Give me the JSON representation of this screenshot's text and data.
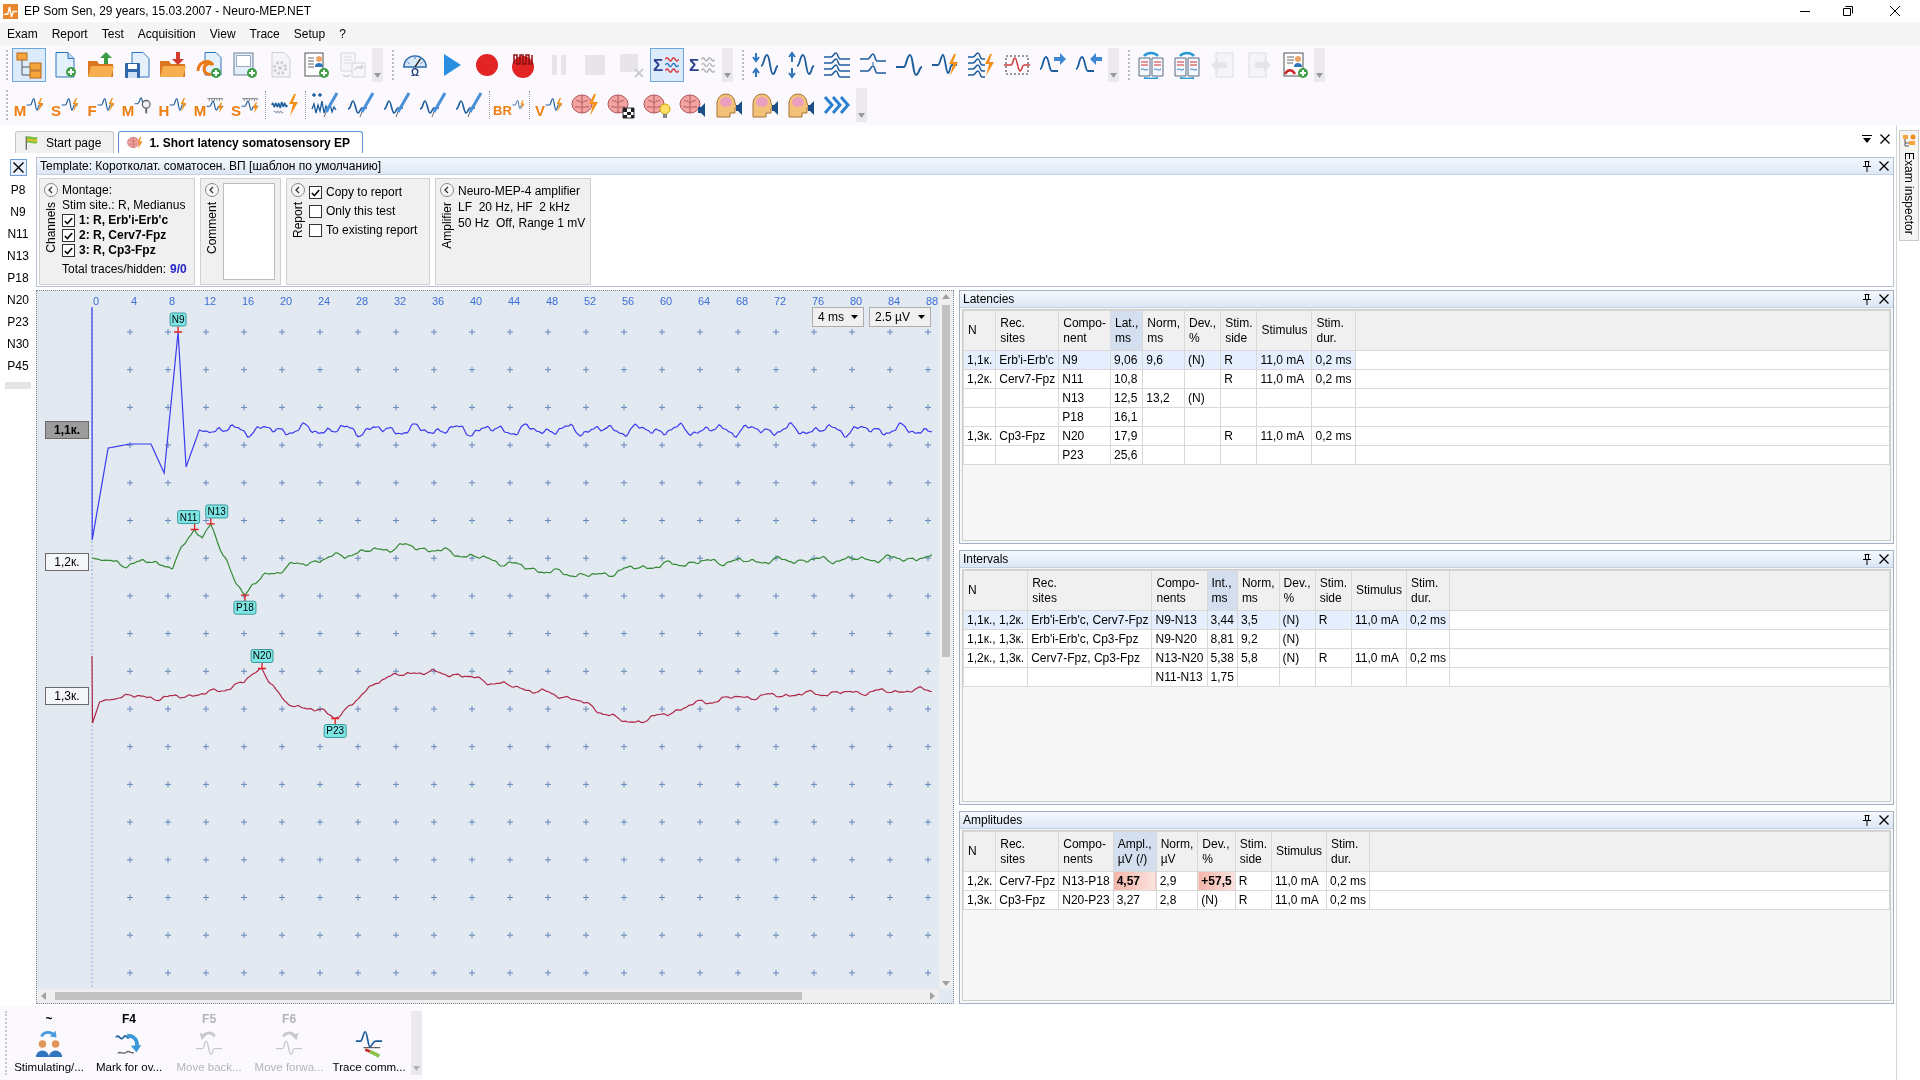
{
  "window": {
    "title": "EP Som Sen, 29 years, 15.03.2007 - Neuro-MEP.NET"
  },
  "menu": [
    "Exam",
    "Report",
    "Test",
    "Acquisition",
    "View",
    "Trace",
    "Setup",
    "?"
  ],
  "toolbar_rows": [
    [
      [
        [
          {
            "kind": "tree",
            "selected": true,
            "disabled": false
          },
          {
            "kind": "doc-plus",
            "selected": false,
            "disabled": false
          },
          {
            "kind": "folder-up",
            "selected": false,
            "disabled": false
          },
          {
            "kind": "save",
            "selected": false,
            "disabled": false
          },
          {
            "kind": "folder-down",
            "selected": false,
            "disabled": false
          },
          {
            "kind": "swirl-doc",
            "selected": false,
            "disabled": false
          },
          {
            "kind": "screen-plus",
            "selected": false,
            "disabled": false
          },
          {
            "kind": "gear-doc",
            "selected": false,
            "disabled": true
          },
          {
            "kind": "person-doc",
            "selected": false,
            "disabled": false
          },
          {
            "kind": "doc-refresh",
            "selected": false,
            "disabled": true
          }
        ]
      ],
      [
        [
          {
            "kind": "gauge",
            "label": "Ω",
            "selected": false,
            "disabled": false
          },
          {
            "kind": "play",
            "selected": false,
            "disabled": false
          },
          {
            "kind": "record",
            "selected": false,
            "disabled": false
          },
          {
            "kind": "record-wave",
            "selected": false,
            "disabled": false
          },
          {
            "kind": "pause",
            "selected": false,
            "disabled": true
          },
          {
            "kind": "stop",
            "selected": false,
            "disabled": true
          },
          {
            "kind": "stop-x",
            "selected": false,
            "disabled": true
          },
          {
            "kind": "sigma",
            "label": "Σ",
            "selected": true,
            "disabled": false
          },
          {
            "kind": "sigma",
            "label": "Σ",
            "selected": false,
            "disabled": true
          }
        ]
      ],
      [
        [
          {
            "kind": "compress",
            "selected": false,
            "disabled": false
          },
          {
            "kind": "expand",
            "selected": false,
            "disabled": false
          },
          {
            "kind": "stack",
            "selected": false,
            "disabled": false
          },
          {
            "kind": "split",
            "selected": false,
            "disabled": false
          },
          {
            "kind": "wave",
            "selected": false,
            "disabled": false
          },
          {
            "kind": "wave-bolt",
            "selected": false,
            "disabled": false
          },
          {
            "kind": "stack-bolt",
            "selected": false,
            "disabled": false
          },
          {
            "kind": "select-wave",
            "selected": false,
            "disabled": false
          },
          {
            "kind": "wave-right",
            "selected": false,
            "disabled": false
          },
          {
            "kind": "wave-left",
            "selected": false,
            "disabled": false
          }
        ]
      ],
      [
        [
          {
            "kind": "book-sync",
            "selected": false,
            "disabled": false
          },
          {
            "kind": "book-sync",
            "selected": false,
            "disabled": false
          },
          {
            "kind": "page-left",
            "selected": false,
            "disabled": true
          },
          {
            "kind": "page-right",
            "selected": false,
            "disabled": true
          },
          {
            "kind": "report-add",
            "selected": false,
            "disabled": false
          }
        ]
      ]
    ],
    [
      [
        [
          {
            "kind": "wave-bolt",
            "label": "M",
            "selected": false,
            "disabled": false
          },
          {
            "kind": "wave-bolt",
            "label": "S",
            "selected": false,
            "disabled": false
          },
          {
            "kind": "wave-bolt",
            "label": "F",
            "selected": false,
            "disabled": false
          },
          {
            "kind": "wave-search",
            "label": "M",
            "selected": false,
            "disabled": false
          },
          {
            "kind": "wave-bolt",
            "label": "H",
            "selected": false,
            "disabled": false
          },
          {
            "kind": "ruler-bolt",
            "label": "M",
            "selected": false,
            "disabled": false
          },
          {
            "kind": "ruler-bolt",
            "label": "S",
            "selected": false,
            "disabled": false
          }
        ],
        [
          {
            "kind": "dense-bolt",
            "selected": false,
            "disabled": false
          }
        ],
        [
          {
            "kind": "needle-noise",
            "selected": false,
            "disabled": false
          },
          {
            "kind": "needle",
            "selected": false,
            "disabled": false
          },
          {
            "kind": "needle",
            "selected": false,
            "disabled": false
          },
          {
            "kind": "needle",
            "selected": false,
            "disabled": false
          },
          {
            "kind": "needle",
            "selected": false,
            "disabled": false
          }
        ],
        [
          {
            "kind": "wave-bolt",
            "label": "BR",
            "selected": false,
            "disabled": false
          }
        ],
        [
          {
            "kind": "wave-bolt",
            "label": "V",
            "selected": false,
            "disabled": false
          },
          {
            "kind": "brain-bolt",
            "selected": false,
            "disabled": false
          },
          {
            "kind": "brain-checker",
            "selected": false,
            "disabled": false
          },
          {
            "kind": "brain-bulb",
            "selected": false,
            "disabled": false
          },
          {
            "kind": "brain-speaker",
            "selected": false,
            "disabled": false
          },
          {
            "kind": "head-speaker",
            "selected": false,
            "disabled": false
          },
          {
            "kind": "head-speaker",
            "selected": false,
            "disabled": false
          },
          {
            "kind": "head-speaker",
            "selected": false,
            "disabled": false
          },
          {
            "kind": "chevrons",
            "selected": false,
            "disabled": false
          }
        ]
      ]
    ]
  ],
  "tabs": [
    {
      "label": "Start page",
      "kind": "flag",
      "selected": false
    },
    {
      "label": "1. Short latency somatosensory EP",
      "kind": "brain-bolt",
      "selected": true
    }
  ],
  "components": [
    "P8",
    "N9",
    "N11",
    "N13",
    "P18",
    "N20",
    "P23",
    "N30",
    "P45"
  ],
  "template": {
    "title": "Template: Коротколат. соматосен. ВП [шаблон по умолчанию]",
    "channels": {
      "label": "Channels",
      "montage": "Montage:",
      "stim_site": "Stim site.: R, Medianus",
      "items": [
        {
          "label": "1: R, Erb'i-Erb'c",
          "checked": true
        },
        {
          "label": "2: R, Cerv7-Fpz",
          "checked": true
        },
        {
          "label": "3: R, Cp3-Fpz",
          "checked": true
        }
      ],
      "total_label": "Total traces/hidden:",
      "total_value": "9/0"
    },
    "comment": {
      "label": "Comment"
    },
    "report": {
      "label": "Report",
      "options": [
        {
          "label": "Copy to report",
          "checked": true
        },
        {
          "label": "Only this test",
          "checked": false
        },
        {
          "label": "To existing report",
          "checked": false
        }
      ]
    },
    "amplifier": {
      "label": "Amplifier",
      "lines": [
        "Neuro-MEP-4 amplifier",
        "LF  20 Hz, HF  2 kHz",
        "50 Hz  Off, Range 1 mV"
      ]
    }
  },
  "chart": {
    "time_ticks": [
      "0",
      "4",
      "8",
      "12",
      "16",
      "20",
      "24",
      "28",
      "32",
      "36",
      "40",
      "44",
      "48",
      "52",
      "56",
      "60",
      "64",
      "68",
      "72",
      "76",
      "80",
      "84",
      "88"
    ],
    "time_scale": "4 ms",
    "amplitude_scale": "2.5 µV",
    "traces": [
      {
        "label": "1,1к.",
        "selected": true,
        "color": "#3b3bf0",
        "markers": [
          {
            "label": "N9"
          }
        ]
      },
      {
        "label": "1,2к.",
        "selected": false,
        "color": "#358a35",
        "markers": [
          {
            "label": "N11"
          },
          {
            "label": "N13"
          },
          {
            "label": "P18"
          }
        ]
      },
      {
        "label": "1,3к.",
        "selected": false,
        "color": "#b02848",
        "markers": [
          {
            "label": "N20"
          },
          {
            "label": "P23"
          }
        ]
      }
    ]
  },
  "latencies": {
    "title": "Latencies",
    "columns": [
      {
        "label": "N",
        "sorted": false
      },
      {
        "label": "Rec.\nsites",
        "sorted": false
      },
      {
        "label": "Compo-\nnent",
        "sorted": false
      },
      {
        "label": "Lat.,\nms",
        "sorted": true
      },
      {
        "label": "Norm,\nms",
        "sorted": false
      },
      {
        "label": "Dev.,\n%",
        "sorted": false
      },
      {
        "label": "Stim.\nside",
        "sorted": false
      },
      {
        "label": "Stimulus",
        "sorted": false
      },
      {
        "label": "Stim.\ndur.",
        "sorted": false
      }
    ],
    "rows": [
      {
        "selected": true,
        "cells": [
          "1,1к.",
          "Erb'i-Erb'c",
          "N9",
          "9,06",
          "9,6",
          "(N)",
          "R",
          "11,0 mA",
          "0,2 ms"
        ]
      },
      {
        "selected": false,
        "cells": [
          "1,2к.",
          "Cerv7-Fpz",
          "N11",
          "10,8",
          null,
          null,
          "R",
          "11,0 mA",
          "0,2 ms"
        ]
      },
      {
        "selected": false,
        "cells": [
          null,
          null,
          "N13",
          "12,5",
          "13,2",
          "(N)"
        ]
      },
      {
        "selected": false,
        "cells": [
          null,
          null,
          "P18",
          "16,1"
        ]
      },
      {
        "selected": false,
        "cells": [
          "1,3к.",
          "Cp3-Fpz",
          "N20",
          "17,9",
          null,
          null,
          "R",
          "11,0 mA",
          "0,2 ms"
        ]
      },
      {
        "selected": false,
        "cells": [
          null,
          null,
          "P23",
          "25,6"
        ]
      }
    ]
  },
  "intervals": {
    "title": "Intervals",
    "columns": [
      {
        "label": "N",
        "sorted": false
      },
      {
        "label": "Rec.\nsites",
        "sorted": false
      },
      {
        "label": "Compo-\nnents",
        "sorted": false
      },
      {
        "label": "Int.,\nms",
        "sorted": true
      },
      {
        "label": "Norm,\nms",
        "sorted": false
      },
      {
        "label": "Dev.,\n%",
        "sorted": false
      },
      {
        "label": "Stim.\nside",
        "sorted": false
      },
      {
        "label": "Stimulus",
        "sorted": false
      },
      {
        "label": "Stim.\ndur.",
        "sorted": false
      }
    ],
    "rows": [
      {
        "selected": true,
        "cells": [
          "1,1к., 1,2к.",
          "Erb'i-Erb'c, Cerv7-Fpz",
          "N9-N13",
          "3,44",
          "3,5",
          "(N)",
          "R",
          "11,0 mA",
          "0,2 ms"
        ]
      },
      {
        "selected": false,
        "cells": [
          "1,1к., 1,3к.",
          "Erb'i-Erb'c, Cp3-Fpz",
          "N9-N20",
          "8,81",
          "9,2",
          "(N)"
        ]
      },
      {
        "selected": false,
        "cells": [
          "1,2к., 1,3к.",
          "Cerv7-Fpz, Cp3-Fpz",
          "N13-N20",
          "5,38",
          "5,8",
          "(N)",
          "R",
          "11,0 mA",
          "0,2 ms"
        ]
      },
      {
        "selected": false,
        "cells": [
          null,
          null,
          "N11-N13",
          "1,75"
        ]
      }
    ]
  },
  "amplitudes": {
    "title": "Amplitudes",
    "columns": [
      {
        "label": "N",
        "sorted": false
      },
      {
        "label": "Rec.\nsites",
        "sorted": false
      },
      {
        "label": "Compo-\nnents",
        "sorted": false
      },
      {
        "label": "Ampl.,\nµV (/)",
        "sorted": true
      },
      {
        "label": "Norm,\nµV",
        "sorted": false
      },
      {
        "label": "Dev.,\n%",
        "sorted": false
      },
      {
        "label": "Stim.\nside",
        "sorted": false
      },
      {
        "label": "Stimulus",
        "sorted": false
      },
      {
        "label": "Stim.\ndur.",
        "sorted": false
      }
    ],
    "rows": [
      {
        "selected": false,
        "cells": [
          {
            "text": "1,2к.",
            "abnormal": false
          },
          {
            "text": "Cerv7-Fpz",
            "abnormal": false
          },
          {
            "text": "N13-P18",
            "abnormal": false
          },
          {
            "text": "4,57",
            "abnormal": true
          },
          {
            "text": "2,9",
            "abnormal": false
          },
          {
            "text": "+57,5",
            "abnormal": true
          },
          {
            "text": "R",
            "abnormal": false
          },
          {
            "text": "11,0 mA",
            "abnormal": false
          },
          {
            "text": "0,2 ms",
            "abnormal": false
          }
        ]
      },
      {
        "selected": false,
        "cells": [
          {
            "text": "1,3к.",
            "abnormal": false
          },
          {
            "text": "Cp3-Fpz",
            "abnormal": false
          },
          {
            "text": "N20-P23",
            "abnormal": false
          },
          {
            "text": "3,27",
            "abnormal": false
          },
          {
            "text": "2,8",
            "abnormal": false
          },
          {
            "text": "(N)",
            "abnormal": false
          },
          {
            "text": "R",
            "abnormal": false
          },
          {
            "text": "11,0 mA",
            "abnormal": false
          },
          {
            "text": "0,2 ms",
            "abnormal": false
          }
        ]
      }
    ]
  },
  "function_keys": [
    {
      "key": "~",
      "label": "Stimulating/...",
      "kind": "swap-people",
      "disabled": false
    },
    {
      "key": "F4",
      "label": "Mark for ov...",
      "kind": "mark-wave",
      "disabled": false
    },
    {
      "key": "F5",
      "label": "Move back...",
      "kind": "wave-back",
      "disabled": true
    },
    {
      "key": "F6",
      "label": "Move forwa...",
      "kind": "wave-forward",
      "disabled": true
    },
    {
      "label": "Trace comm...",
      "kind": "wave-pen",
      "disabled": false
    }
  ],
  "side_panel": {
    "label": "Exam inspector"
  }
}
